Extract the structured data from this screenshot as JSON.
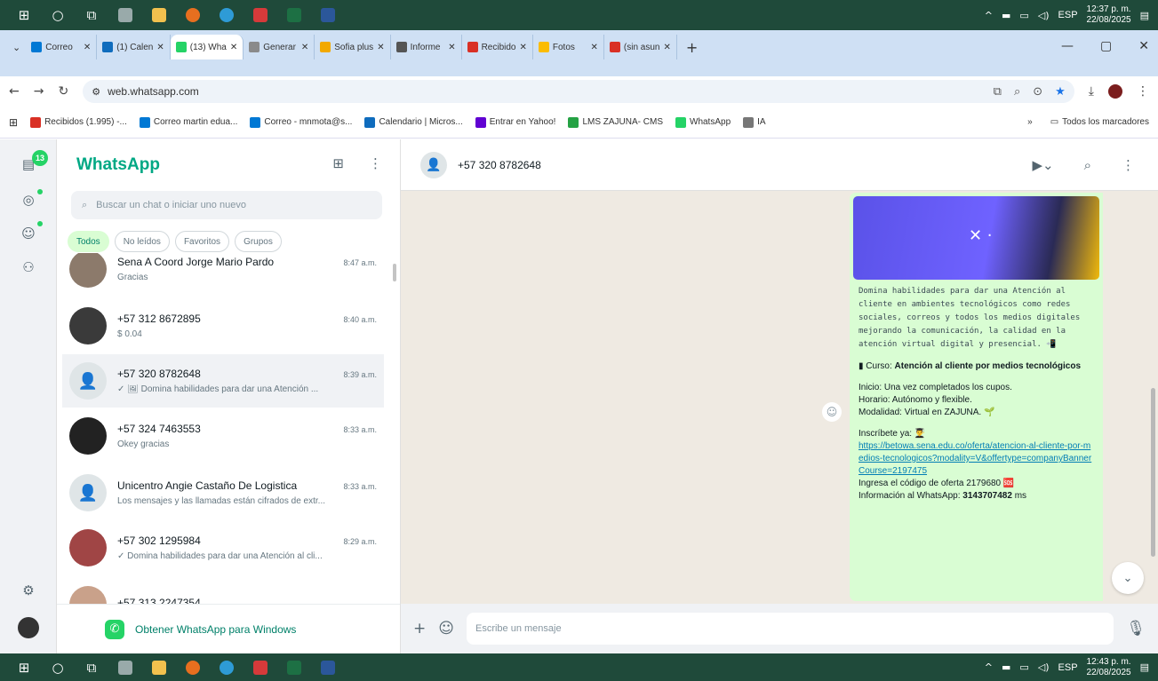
{
  "taskbar": {
    "icons": [
      "windows-start-icon",
      "search-icon",
      "task-view-icon",
      "app-icon",
      "file-explorer-icon",
      "firefox-icon",
      "app-icon",
      "app-icon",
      "excel-icon",
      "word-icon"
    ],
    "lang": "ESP",
    "top_time": "12:37 p. m.",
    "top_date": "22/08/2025",
    "bottom_time": "12:43 p. m.",
    "bottom_date": "22/08/2025"
  },
  "tabs": [
    {
      "label": "Correo",
      "color": "#0078d4"
    },
    {
      "label": "(1) Calen",
      "color": "#0f6cbd"
    },
    {
      "label": "(13) Wha",
      "color": "#25d366",
      "active": true
    },
    {
      "label": "Generar",
      "color": "#8a8a8a"
    },
    {
      "label": "Sofia plus",
      "color": "#f2a900"
    },
    {
      "label": "Informe",
      "color": "#555555"
    },
    {
      "label": "Recibido",
      "color": "#d93025"
    },
    {
      "label": "Fotos",
      "color": "#fbbc04"
    },
    {
      "label": "(sin asun",
      "color": "#d93025"
    }
  ],
  "address": {
    "url": "web.whatsapp.com"
  },
  "bookmarks": [
    {
      "label": "Recibidos (1.995) -...",
      "color": "#d93025"
    },
    {
      "label": "Correo martin edua...",
      "color": "#0078d4"
    },
    {
      "label": "Correo - mnmota@s...",
      "color": "#0078d4"
    },
    {
      "label": "Calendario | Micros...",
      "color": "#0f6cbd"
    },
    {
      "label": "Entrar en Yahoo!",
      "color": "#6001d2"
    },
    {
      "label": "LMS ZAJUNA- CMS",
      "color": "#25a244"
    },
    {
      "label": "WhatsApp",
      "color": "#25d366"
    },
    {
      "label": "IA",
      "color": "#777777"
    }
  ],
  "bookmarks_all": "Todos los marcadores",
  "rail": {
    "badge": "13"
  },
  "chats": {
    "title": "WhatsApp",
    "search_placeholder": "Buscar un chat o iniciar uno nuevo",
    "filters": [
      "Todos",
      "No leídos",
      "Favoritos",
      "Grupos"
    ],
    "items": [
      {
        "name": "Sena A Coord Jorge Mario Pardo",
        "time": "8:47 a.m.",
        "preview": "Gracias",
        "avatar": "photo",
        "color": "#8c7a6b"
      },
      {
        "name": "+57 312 8672895",
        "time": "8:40 a.m.",
        "preview": "$ 0.04",
        "avatar": "photo",
        "color": "#3a3a3a"
      },
      {
        "name": "+57 320 8782648",
        "time": "8:39 a.m.",
        "preview": "✓ 🖼 Domina habilidades para dar una Atención ...",
        "avatar": "placeholder",
        "selected": true
      },
      {
        "name": "+57 324 7463553",
        "time": "8:33 a.m.",
        "preview": "Okey gracias",
        "avatar": "photo",
        "color": "#222222"
      },
      {
        "name": "Unicentro Angie Castaño De Logistica",
        "time": "8:33 a.m.",
        "preview": "Los mensajes y las llamadas están cifrados de extr...",
        "avatar": "placeholder"
      },
      {
        "name": "+57 302 1295984",
        "time": "8:29 a.m.",
        "preview": "✓ Domina habilidades para dar una Atención al cli...",
        "avatar": "photo",
        "color": "#a04545"
      },
      {
        "name": "+57 313 2247354",
        "time": "",
        "preview": "",
        "avatar": "photo",
        "color": "#c9a18a"
      }
    ],
    "get_app": "Obtener WhatsApp para Windows"
  },
  "conversation": {
    "contact": "+57 320 8782648",
    "message": {
      "intro": "Domina habilidades para dar una Atención al cliente en ambientes tecnológicos como redes sociales, correos y todos los medios digitales mejorando la comunicación, la calidad en la atención virtual digital y presencial. 📲",
      "course_label": "Curso:",
      "course_name": "Atención al cliente por medios tecnológicos",
      "inicio": "Inicio: Una vez completados los cupos.",
      "horario": "Horario: Autónomo y flexible.",
      "modalidad": "Modalidad: Virtual en ZAJUNA. 🌱",
      "inscribete": "Inscríbete ya: 👨‍🎓",
      "link": "https://betowa.sena.edu.co/oferta/atencion-al-cliente-por-medios-tecnologicos?modality=V&offertype=companyBannerCourse=2197475",
      "codigo": "Ingresa el código de oferta 2179680 🆘",
      "info_prefix": "Información al WhatsApp:",
      "info_phone": "3143707482",
      "info_suffix": "ms"
    },
    "composer_placeholder": "Escribe un mensaje"
  }
}
